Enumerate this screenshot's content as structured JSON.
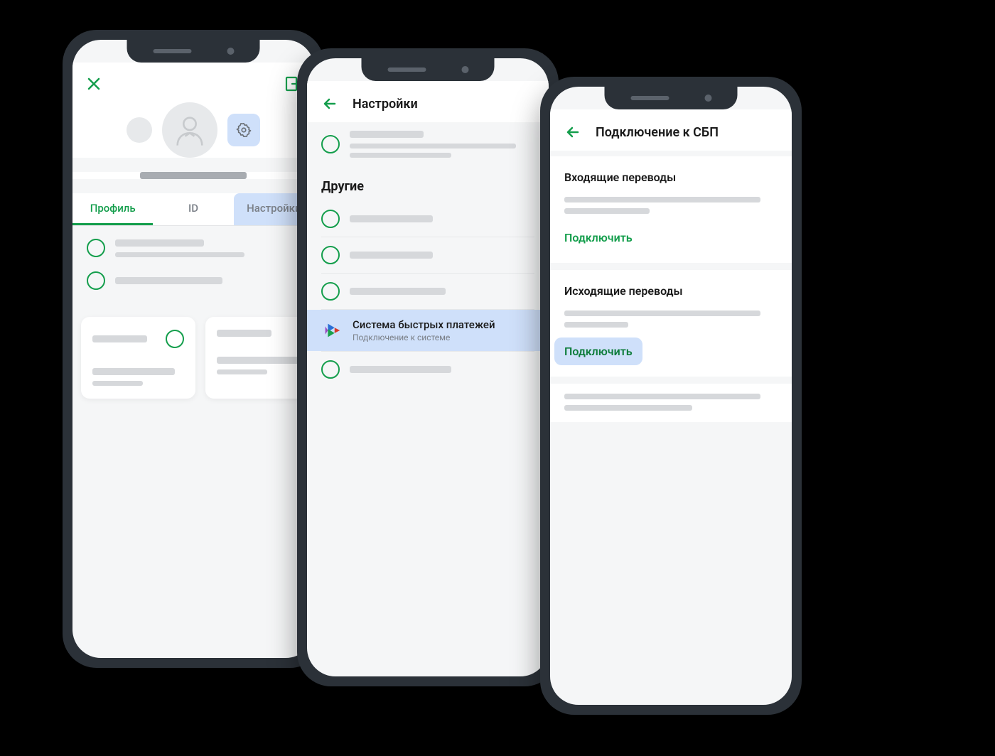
{
  "phone1": {
    "tabs": {
      "profile": "Профиль",
      "id": "ID",
      "settings": "Настройки"
    }
  },
  "phone2": {
    "header": "Настройки",
    "section_other": "Другие",
    "sbp": {
      "title": "Система быстрых платежей",
      "subtitle": "Подключение к системе"
    }
  },
  "phone3": {
    "header": "Подключение к СБП",
    "incoming": {
      "title": "Входящие переводы",
      "action": "Подключить"
    },
    "outgoing": {
      "title": "Исходящие переводы",
      "action": "Подключить"
    }
  }
}
